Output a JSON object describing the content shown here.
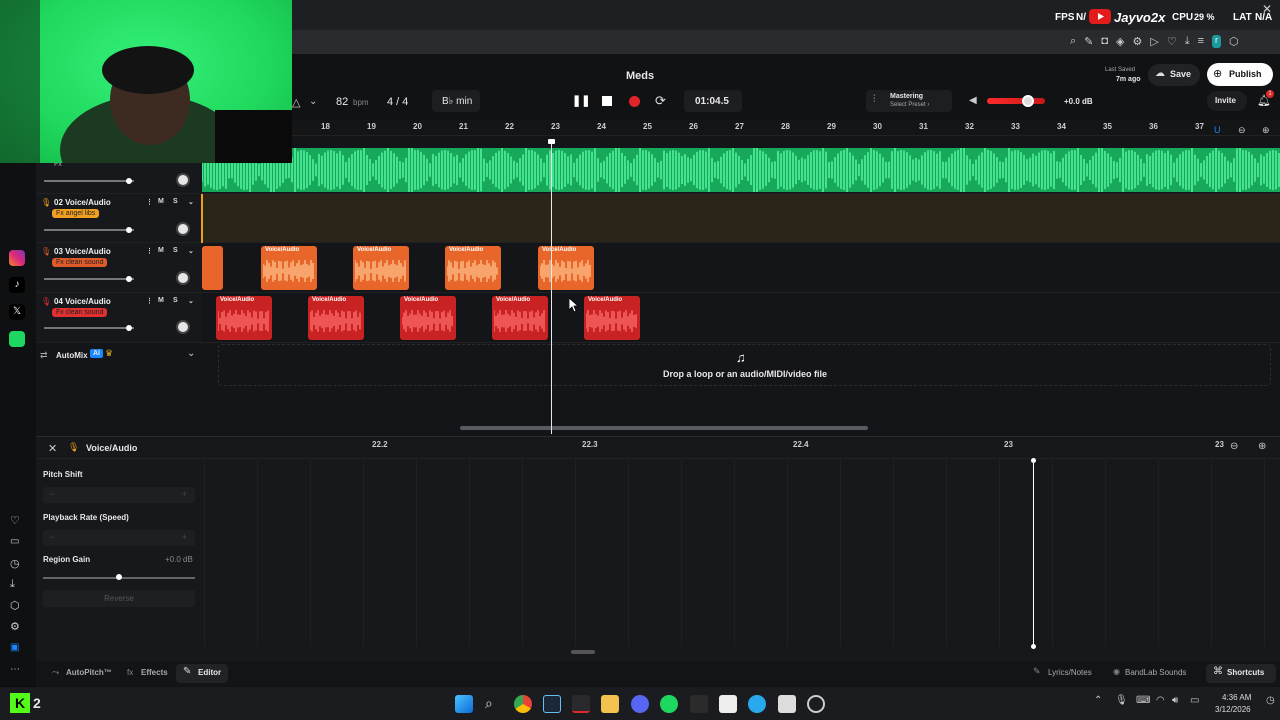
{
  "overlay": {
    "fps_label": "FPS",
    "fps_value": "N/",
    "channel_name": "Jayvo2x",
    "cpu_label": "CPU",
    "cpu_value": "29 %",
    "lat_label": "LAT",
    "lat_value": "N/A"
  },
  "header": {
    "project_title": "Meds",
    "bpm_value": "82",
    "bpm_unit": "bpm",
    "time_signature": "4 / 4",
    "key": "B♭ min",
    "time_display": "01:04.5",
    "mastering_label": "Mastering",
    "mastering_sub": "Select Preset ›",
    "volume_db": "+0.0 dB",
    "volume_level": 0.7,
    "last_saved_label": "Last Saved",
    "last_saved_time": "7m ago",
    "save_label": "Save",
    "publish_label": "Publish",
    "invite_label": "Invite",
    "notification_count": "1"
  },
  "ruler": {
    "bars": [
      "18",
      "19",
      "20",
      "21",
      "22",
      "23",
      "24",
      "25",
      "26",
      "27",
      "28",
      "29",
      "30",
      "31",
      "32",
      "33",
      "34",
      "35",
      "36",
      "37"
    ]
  },
  "tracks": [
    {
      "name": "02 Voice/Audio",
      "fx": "Fx angel libs",
      "fx_color": "#f0a020"
    },
    {
      "name": "03 Voice/Audio",
      "fx": "Fx clean sound",
      "fx_color": "#e05a2a"
    },
    {
      "name": "04 Voice/Audio",
      "fx": "Fx clean sound",
      "fx_color": "#e03030"
    }
  ],
  "top_track_fx": "Fx",
  "clip_label": "Voice/Audio",
  "automix": {
    "label": "AutoMix",
    "badge": "AI"
  },
  "drop_zone_text": "Drop a loop or an audio/MIDI/video file",
  "editor": {
    "title": "Voice/Audio",
    "ruler": [
      "22.2",
      "22.3",
      "22.4",
      "23",
      "23"
    ],
    "pitch_shift_label": "Pitch Shift",
    "playback_rate_label": "Playback Rate (Speed)",
    "region_gain_label": "Region Gain",
    "region_gain_value": "+0.0 dB",
    "reverse_label": "Reverse",
    "pitch_shift_minus": "−",
    "pitch_shift_plus": "+",
    "playback_minus": "−",
    "playback_plus": "+"
  },
  "footer": {
    "autopitch_label": "AutoPitch™",
    "effects_label": "Effects",
    "editor_label": "Editor",
    "lyrics_label": "Lyrics/Notes",
    "sounds_label": "BandLab Sounds",
    "shortcuts_label": "Shortcuts"
  },
  "taskbar": {
    "kick_label": "2",
    "time": "4:36 AM",
    "date": "3/12/2026"
  },
  "colors": {
    "green_track": "#1fbf6a",
    "orange_clip": "#e8662a",
    "red_clip": "#c92222",
    "accent_blue": "#1a88ff"
  }
}
